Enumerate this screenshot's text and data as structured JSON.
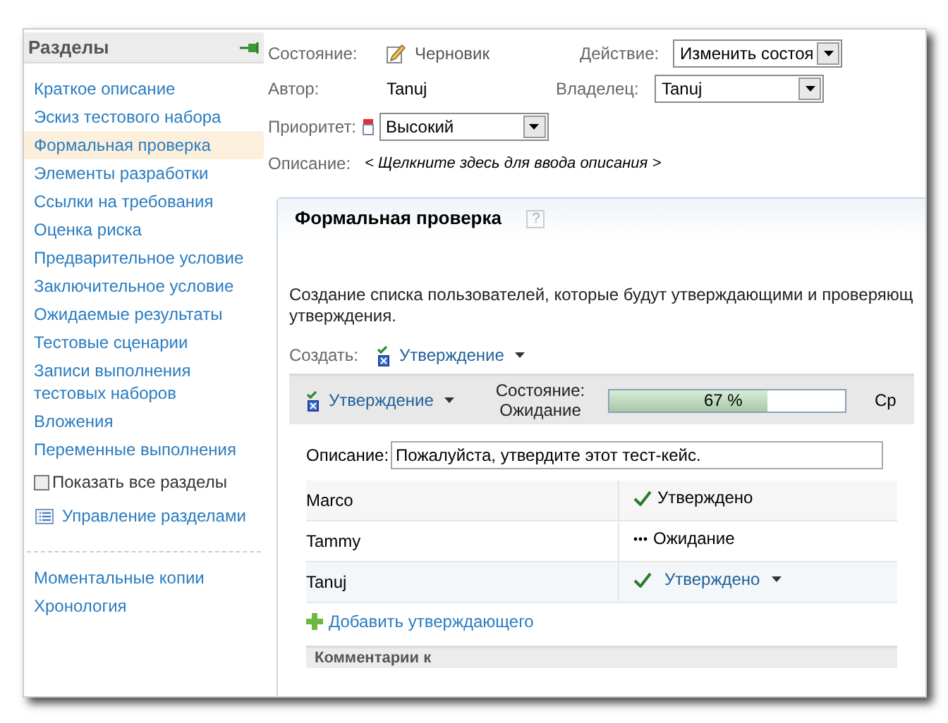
{
  "sidebar": {
    "title": "Разделы",
    "items": [
      {
        "label": "Краткое описание",
        "selected": false
      },
      {
        "label": "Эскиз тестового набора",
        "selected": false
      },
      {
        "label": "Формальная проверка",
        "selected": true
      },
      {
        "label": "Элементы разработки",
        "selected": false
      },
      {
        "label": "Ссылки на требования",
        "selected": false
      },
      {
        "label": "Оценка риска",
        "selected": false
      },
      {
        "label": "Предварительное условие",
        "selected": false
      },
      {
        "label": "Заключительное условие",
        "selected": false
      },
      {
        "label": "Ожидаемые результаты",
        "selected": false
      },
      {
        "label": "Тестовые сценарии",
        "selected": false
      },
      {
        "label": "Записи выполнения тестовых наборов",
        "selected": false
      },
      {
        "label": "Вложения",
        "selected": false
      },
      {
        "label": "Переменные выполнения",
        "selected": false
      }
    ],
    "show_all": {
      "label": "Показать все разделы",
      "checked": false
    },
    "manage": "Управление разделами",
    "extra_links": [
      "Моментальные копии",
      "Хронология"
    ]
  },
  "header": {
    "state_label": "Состояние:",
    "state_value": "Черновик",
    "action_label": "Действие:",
    "action_value": "Изменить состоя",
    "author_label": "Автор:",
    "author_value": "Tanuj",
    "owner_label": "Владелец:",
    "owner_value": "Tanuj",
    "priority_label": "Приоритет:",
    "priority_value": "Высокий",
    "description_label": "Описание:",
    "description_placeholder": "< Щелкните здесь для ввода описания >"
  },
  "panel": {
    "title": "Формальная проверка",
    "help": "?",
    "description_lines": [
      "Создание списка пользователей, которые будут утверждающими и проверяющ",
      "утверждения."
    ],
    "create_label": "Создать:",
    "create_value": "Утверждение",
    "approval": {
      "name": "Утверждение",
      "state_line1": "Состояние:",
      "state_line2": "Ожидание",
      "level": 0.67,
      "reading": "67 %",
      "column_3": "Ср"
    },
    "description_label": "Описание:",
    "description_value": "Пожалуйста, утвердите этот тест-кейс.",
    "rows": [
      {
        "name": "Marco",
        "status": "Утверждено",
        "kind": "approved",
        "selected": false
      },
      {
        "name": "Tammy",
        "status": "Ожидание",
        "kind": "pending",
        "selected": false
      },
      {
        "name": "Tanuj",
        "status": "Утверждено",
        "kind": "approved",
        "selected": true
      }
    ],
    "add_approver": "Добавить утверждающего",
    "comments": "Комментарии к"
  }
}
